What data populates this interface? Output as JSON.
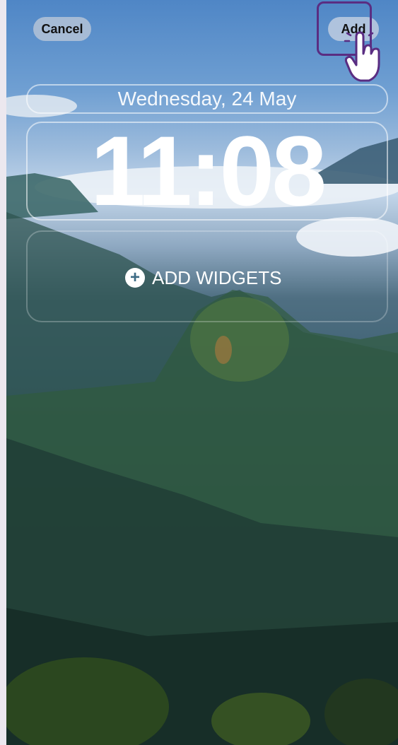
{
  "header": {
    "cancel_label": "Cancel",
    "add_label": "Add"
  },
  "lock_screen": {
    "date": "Wednesday, 24 May",
    "time": "11:08",
    "add_widgets_label": "ADD WIDGETS"
  },
  "icons": {
    "add_widgets": "plus-circle-icon",
    "pointer": "hand-pointer-icon"
  },
  "colors": {
    "highlight_border": "#5a2d82"
  }
}
